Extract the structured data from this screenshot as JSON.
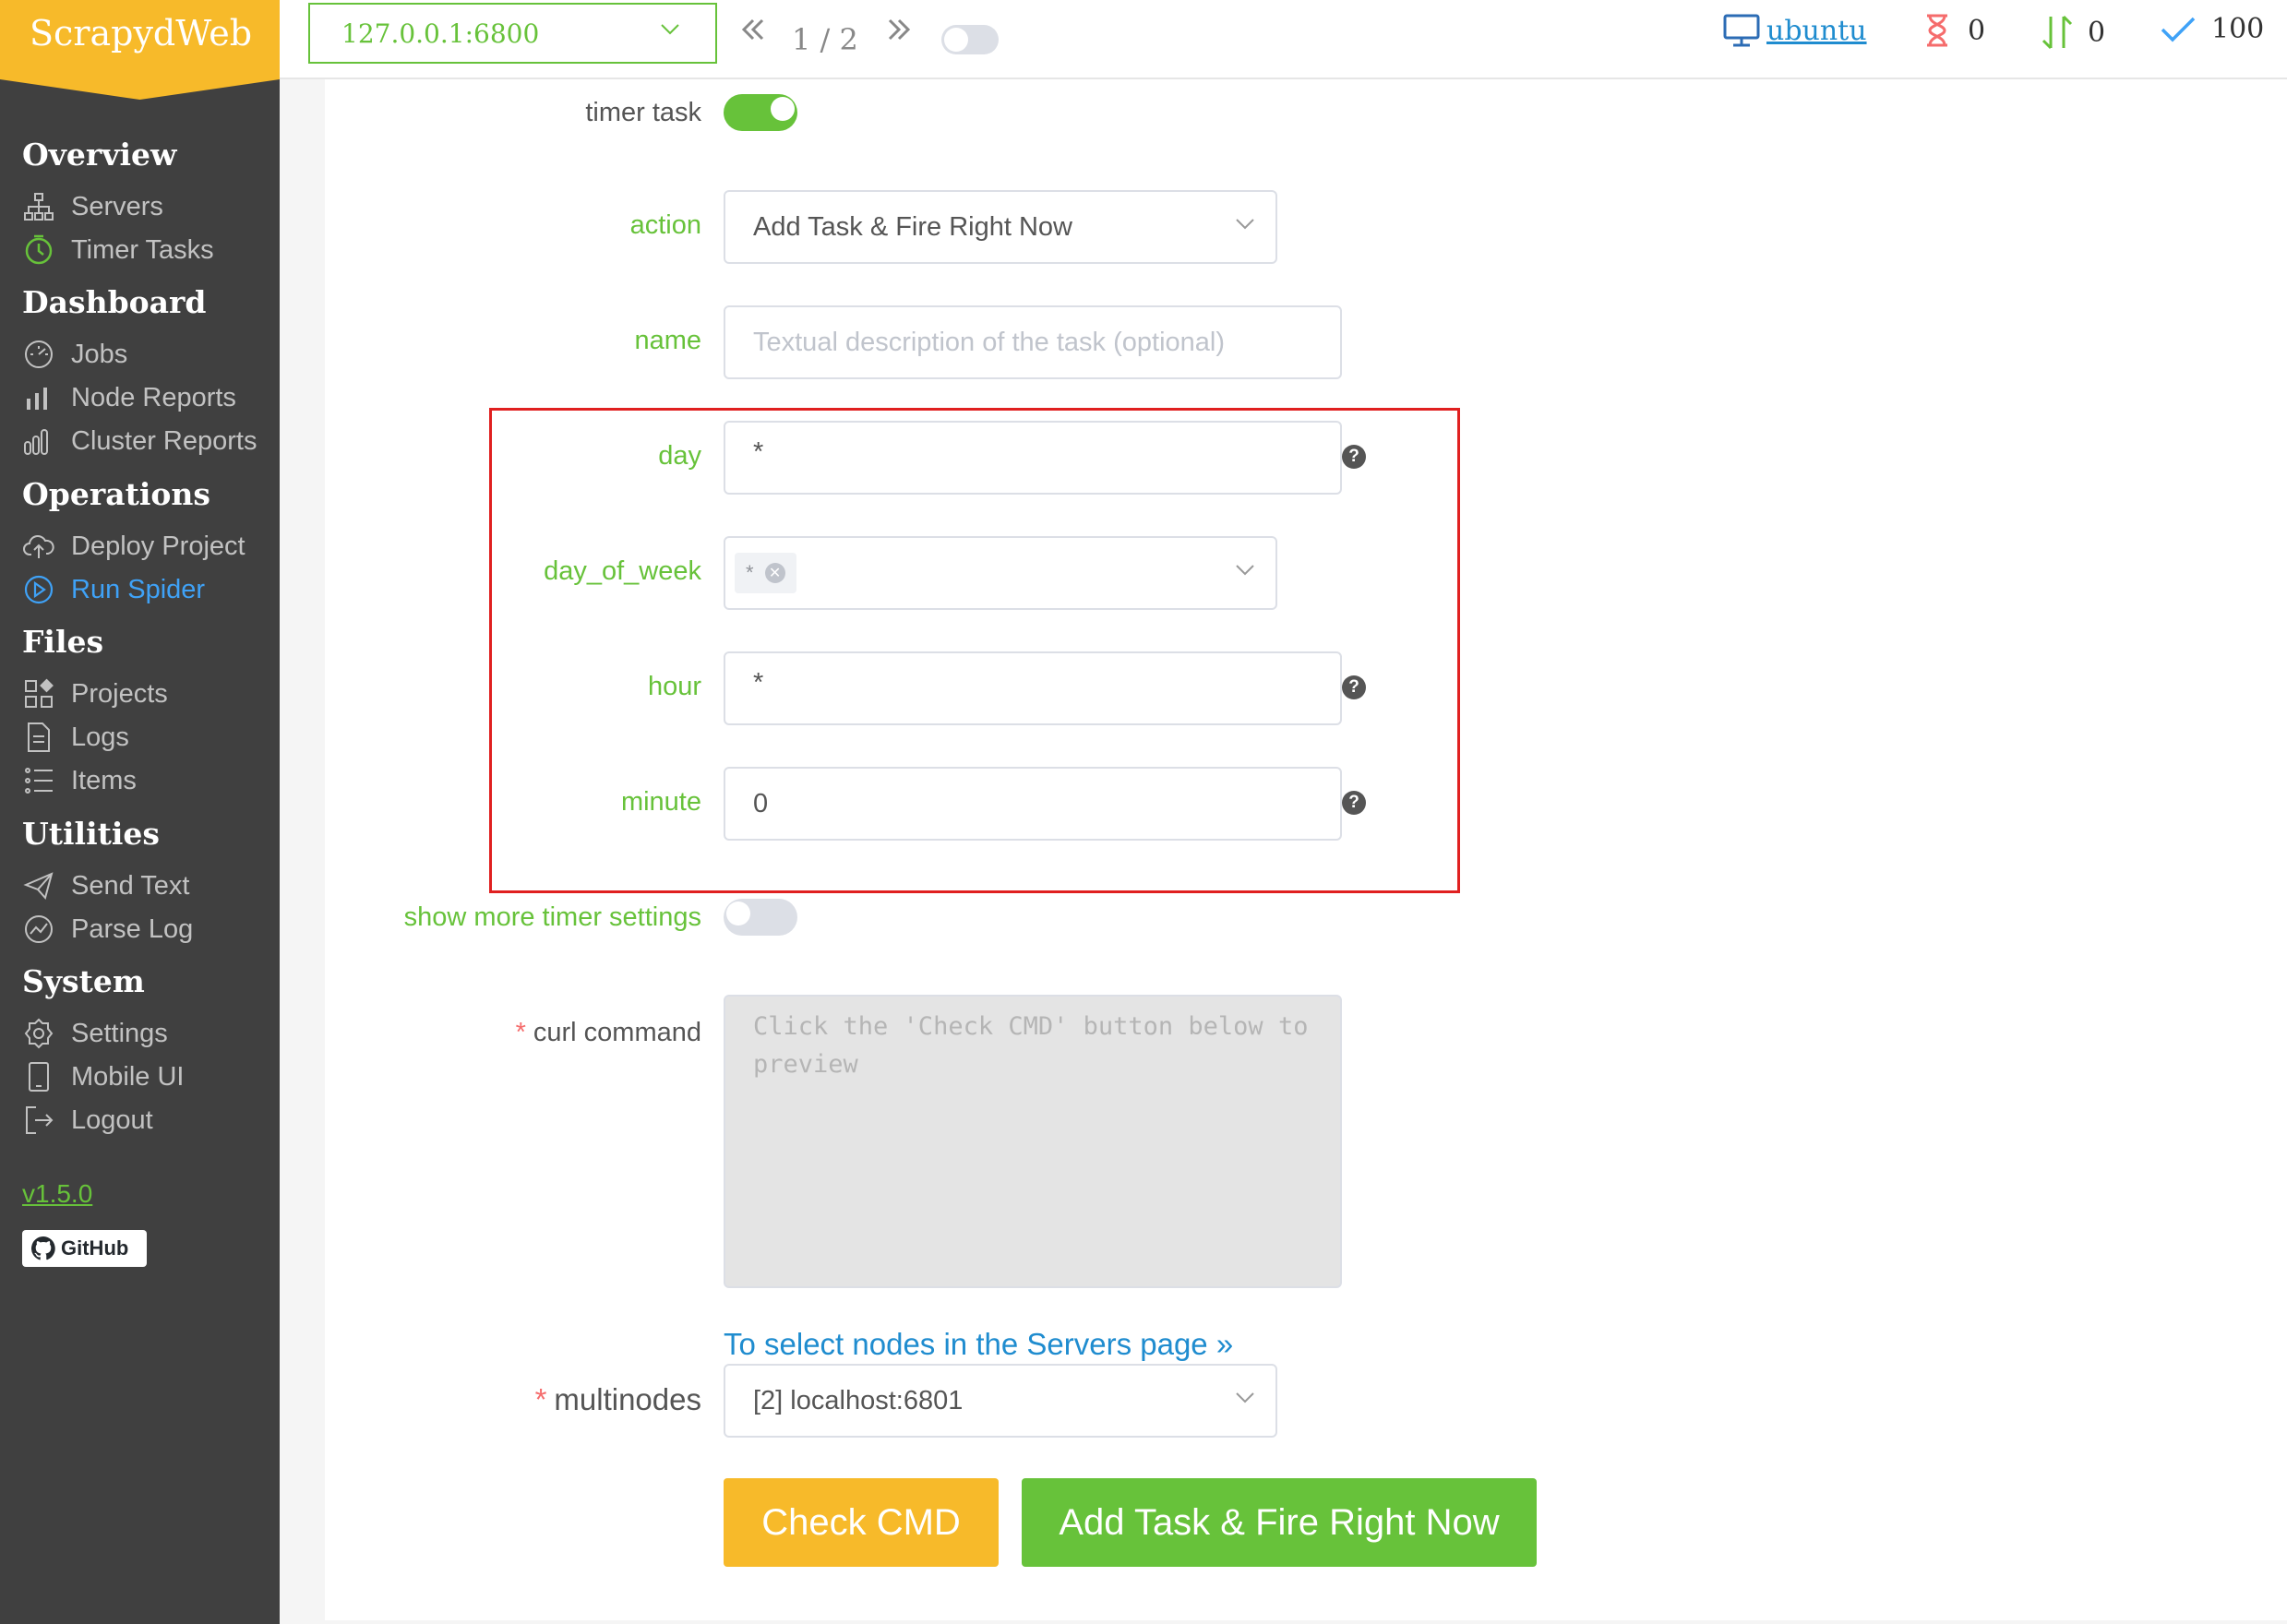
{
  "app": {
    "logo": "ScrapydWeb",
    "version": "v1.5.0",
    "github_label": "GitHub"
  },
  "sidebar": {
    "sections": [
      {
        "title": "Overview",
        "items": [
          {
            "label": "Servers",
            "icon": "sitemap-icon"
          },
          {
            "label": "Timer Tasks",
            "icon": "clock-icon"
          }
        ]
      },
      {
        "title": "Dashboard",
        "items": [
          {
            "label": "Jobs",
            "icon": "speedometer-icon"
          },
          {
            "label": "Node Reports",
            "icon": "bar-chart-icon"
          },
          {
            "label": "Cluster Reports",
            "icon": "bar-chart-rounded-icon"
          }
        ]
      },
      {
        "title": "Operations",
        "items": [
          {
            "label": "Deploy Project",
            "icon": "cloud-upload-icon"
          },
          {
            "label": "Run Spider",
            "icon": "play-circle-icon"
          }
        ]
      },
      {
        "title": "Files",
        "items": [
          {
            "label": "Projects",
            "icon": "grid-icon"
          },
          {
            "label": "Logs",
            "icon": "document-icon"
          },
          {
            "label": "Items",
            "icon": "list-icon"
          }
        ]
      },
      {
        "title": "Utilities",
        "items": [
          {
            "label": "Send Text",
            "icon": "paper-plane-icon"
          },
          {
            "label": "Parse Log",
            "icon": "chart-circle-icon"
          }
        ]
      },
      {
        "title": "System",
        "items": [
          {
            "label": "Settings",
            "icon": "gear-icon"
          },
          {
            "label": "Mobile UI",
            "icon": "mobile-icon"
          },
          {
            "label": "Logout",
            "icon": "logout-icon"
          }
        ]
      }
    ]
  },
  "topbar": {
    "server": "127.0.0.1:6800",
    "page": "1 / 2",
    "user": "ubuntu",
    "pending": "0",
    "running": "0",
    "finished": "100"
  },
  "form": {
    "timer_task_label": "timer task",
    "action_label": "action",
    "action_value": "Add Task & Fire Right Now",
    "name_label": "name",
    "name_placeholder": "Textual description of the task (optional)",
    "day_label": "day",
    "day_value": "*",
    "dow_label": "day_of_week",
    "dow_tag": "*",
    "hour_label": "hour",
    "hour_value": "*",
    "minute_label": "minute",
    "minute_value": "0",
    "more_label": "show more timer settings",
    "curl_label": "curl command",
    "curl_placeholder": "Click the 'Check CMD' button below to preview",
    "nodes_link": "To select nodes in the Servers page »",
    "multinodes_label": "multinodes",
    "multinodes_value": "[2] localhost:6801",
    "check_button": "Check CMD",
    "submit_button": "Add Task & Fire Right Now"
  },
  "colors": {
    "accent": "#67c23a",
    "logo": "#f7ba2a",
    "sidebar": "#404040",
    "active": "#3fa2f7",
    "highlight": "#e02020",
    "danger": "#f56c6c"
  }
}
